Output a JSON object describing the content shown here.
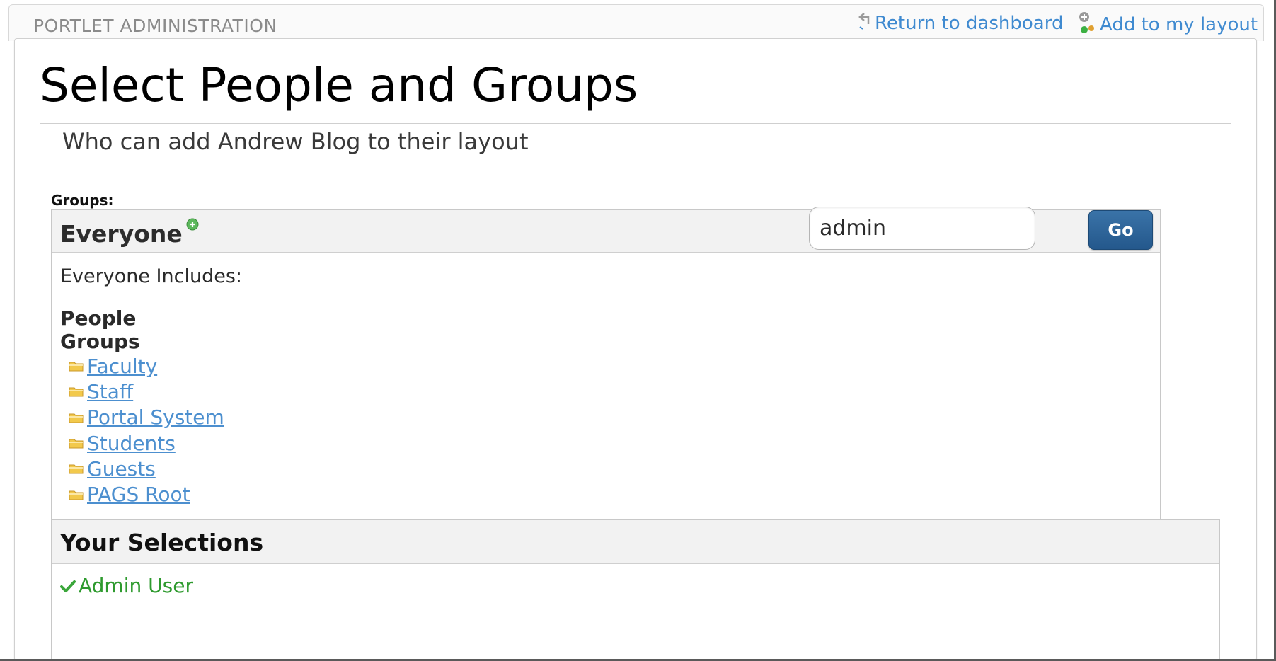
{
  "portlet": {
    "title": "PORTLET ADMINISTRATION",
    "return_link": "Return to dashboard",
    "add_link": "Add to my layout"
  },
  "page": {
    "title": "Select People and Groups",
    "subtitle": "Who can add Andrew Blog to their layout"
  },
  "groups_label": "Groups:",
  "browser": {
    "current_group": "Everyone",
    "search_value": "admin",
    "go_label": "Go",
    "includes_label": "Everyone Includes:",
    "people_heading": "People",
    "groups_heading": "Groups",
    "groups": [
      {
        "label": "Faculty"
      },
      {
        "label": "Staff"
      },
      {
        "label": "Portal System"
      },
      {
        "label": "Students"
      },
      {
        "label": "Guests"
      },
      {
        "label": "PAGS Root"
      }
    ]
  },
  "selections": {
    "heading": "Your Selections",
    "items": [
      {
        "label": "Admin User"
      }
    ]
  },
  "colors": {
    "link": "#4c8fcf",
    "button": "#2c6296",
    "selected": "#2e9a2e"
  }
}
